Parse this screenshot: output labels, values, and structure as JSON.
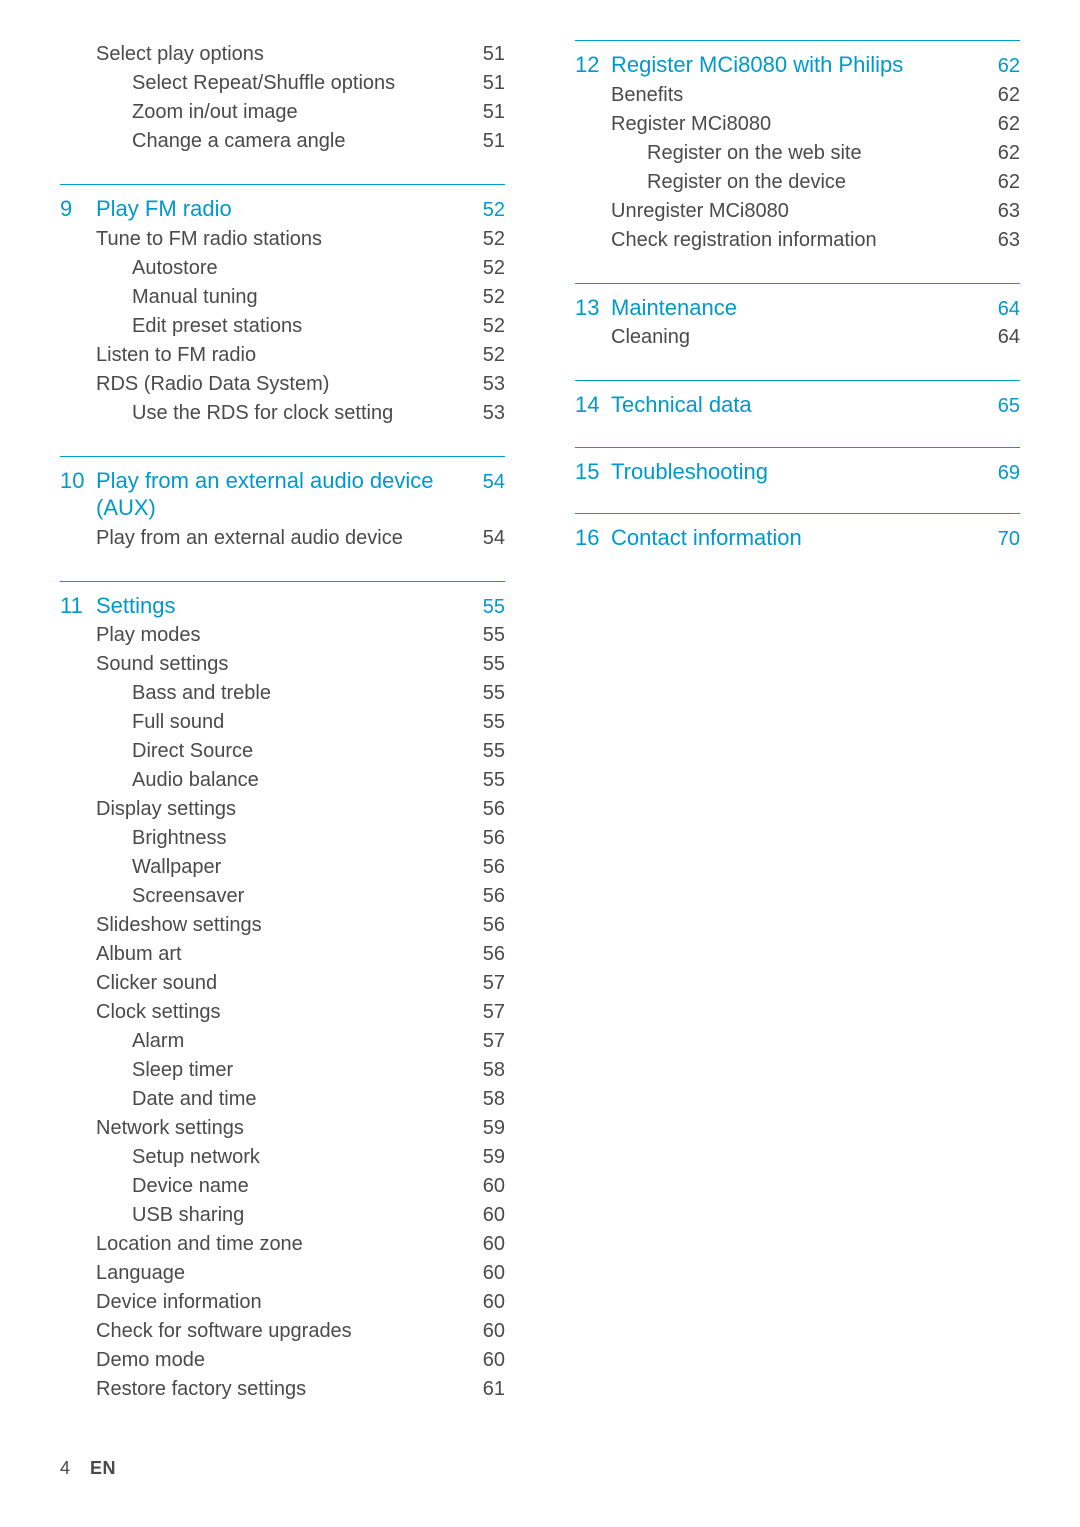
{
  "footer": {
    "page_num": "4",
    "lang": "EN"
  },
  "left_col": [
    {
      "num": "",
      "title": "",
      "page": "",
      "no_rule": true,
      "rows": [
        {
          "label": "Select play options",
          "indent": 0,
          "page": "51"
        },
        {
          "label": "Select Repeat/Shuffle options",
          "indent": 1,
          "page": "51"
        },
        {
          "label": "Zoom in/out image",
          "indent": 1,
          "page": "51"
        },
        {
          "label": "Change a camera angle",
          "indent": 1,
          "page": "51"
        }
      ]
    },
    {
      "num": "9",
      "title": "Play FM radio",
      "page": "52",
      "rows": [
        {
          "label": "Tune to FM radio stations",
          "indent": 0,
          "page": "52"
        },
        {
          "label": "Autostore",
          "indent": 1,
          "page": "52"
        },
        {
          "label": "Manual tuning",
          "indent": 1,
          "page": "52"
        },
        {
          "label": "Edit preset stations",
          "indent": 1,
          "page": "52"
        },
        {
          "label": "Listen to FM radio",
          "indent": 0,
          "page": "52"
        },
        {
          "label": "RDS (Radio Data System)",
          "indent": 0,
          "page": "53"
        },
        {
          "label": "Use the RDS for clock setting",
          "indent": 1,
          "page": "53"
        }
      ]
    },
    {
      "num": "10",
      "title": "Play from an external audio device (AUX)",
      "page": "54",
      "rows": [
        {
          "label": "Play from an external audio device",
          "indent": 0,
          "page": "54"
        }
      ]
    },
    {
      "num": "11",
      "title": "Settings",
      "page": "55",
      "rows": [
        {
          "label": "Play modes",
          "indent": 0,
          "page": "55"
        },
        {
          "label": "Sound settings",
          "indent": 0,
          "page": "55"
        },
        {
          "label": "Bass and treble",
          "indent": 1,
          "page": "55"
        },
        {
          "label": "Full sound",
          "indent": 1,
          "page": "55"
        },
        {
          "label": "Direct Source",
          "indent": 1,
          "page": "55"
        },
        {
          "label": "Audio balance",
          "indent": 1,
          "page": "55"
        },
        {
          "label": "Display settings",
          "indent": 0,
          "page": "56"
        },
        {
          "label": "Brightness",
          "indent": 1,
          "page": "56"
        },
        {
          "label": "Wallpaper",
          "indent": 1,
          "page": "56"
        },
        {
          "label": "Screensaver",
          "indent": 1,
          "page": "56"
        },
        {
          "label": "Slideshow settings",
          "indent": 0,
          "page": "56"
        },
        {
          "label": "Album art",
          "indent": 0,
          "page": "56"
        },
        {
          "label": "Clicker sound",
          "indent": 0,
          "page": "57"
        },
        {
          "label": "Clock settings",
          "indent": 0,
          "page": "57"
        },
        {
          "label": "Alarm",
          "indent": 1,
          "page": "57"
        },
        {
          "label": "Sleep timer",
          "indent": 1,
          "page": "58"
        },
        {
          "label": "Date and time",
          "indent": 1,
          "page": "58"
        },
        {
          "label": "Network settings",
          "indent": 0,
          "page": "59"
        },
        {
          "label": "Setup network",
          "indent": 1,
          "page": "59"
        },
        {
          "label": "Device name",
          "indent": 1,
          "page": "60"
        },
        {
          "label": "USB sharing",
          "indent": 1,
          "page": "60"
        },
        {
          "label": "Location and time zone",
          "indent": 0,
          "page": "60"
        },
        {
          "label": "Language",
          "indent": 0,
          "page": "60"
        },
        {
          "label": "Device information",
          "indent": 0,
          "page": "60"
        },
        {
          "label": "Check for software upgrades",
          "indent": 0,
          "page": "60"
        },
        {
          "label": "Demo mode",
          "indent": 0,
          "page": "60"
        },
        {
          "label": "Restore factory settings",
          "indent": 0,
          "page": "61"
        }
      ]
    }
  ],
  "right_col": [
    {
      "num": "12",
      "title": "Register MCi8080 with Philips",
      "page": "62",
      "rows": [
        {
          "label": "Benefits",
          "indent": 0,
          "page": "62"
        },
        {
          "label": "Register MCi8080",
          "indent": 0,
          "page": "62"
        },
        {
          "label": "Register on the web site",
          "indent": 1,
          "page": "62"
        },
        {
          "label": "Register on the device",
          "indent": 1,
          "page": "62"
        },
        {
          "label": "Unregister MCi8080",
          "indent": 0,
          "page": "63"
        },
        {
          "label": "Check registration information",
          "indent": 0,
          "page": "63"
        }
      ]
    },
    {
      "num": "13",
      "title": "Maintenance",
      "page": "64",
      "rows": [
        {
          "label": "Cleaning",
          "indent": 0,
          "page": "64"
        }
      ]
    },
    {
      "num": "14",
      "title": "Technical data",
      "page": "65",
      "rows": []
    },
    {
      "num": "15",
      "title": "Troubleshooting",
      "page": "69",
      "rows": []
    },
    {
      "num": "16",
      "title": "Contact information",
      "page": "70",
      "rows": []
    }
  ]
}
